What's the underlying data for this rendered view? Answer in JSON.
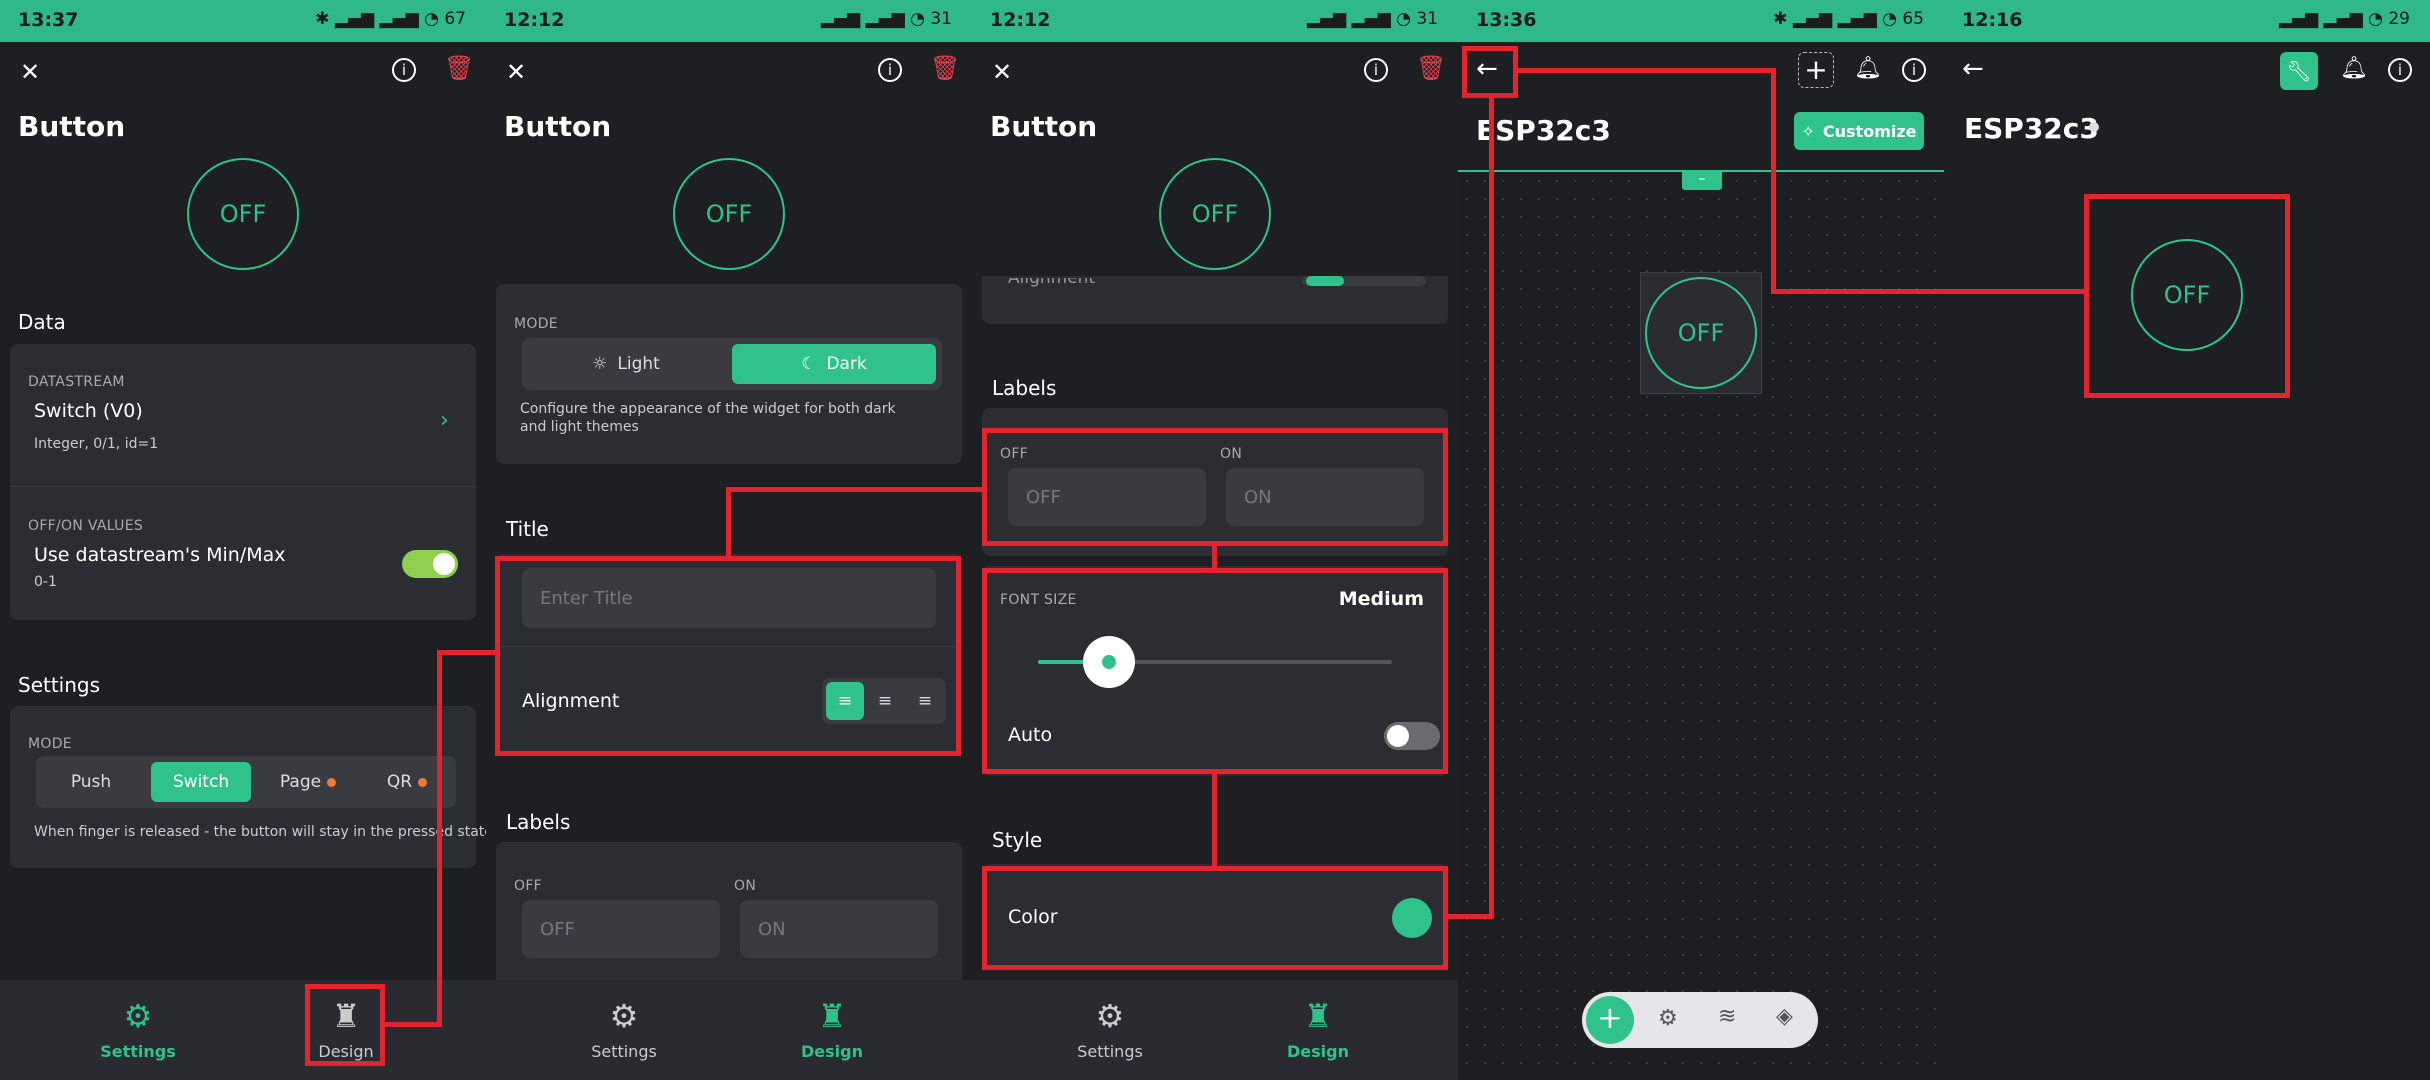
{
  "panels": {
    "p1": {
      "status_time": "13:37",
      "status_right": "✱ ▂▄▆ ▂▄▆ ◔ 67",
      "title": "Button",
      "widget_text": "OFF",
      "data_heading": "Data",
      "datastream_cap": "DATASTREAM",
      "datastream_name": "Switch (V0)",
      "datastream_meta": "Integer, 0/1, id=1",
      "offon_cap": "OFF/ON VALUES",
      "offon_text": "Use datastream's Min/Max",
      "offon_range": "0-1",
      "settings_heading": "Settings",
      "mode_cap": "MODE",
      "modes": [
        "Push",
        "Switch",
        "Page",
        "QR"
      ],
      "mode_help": "When finger is released - the button will stay in the pressed state",
      "nav_settings": "Settings",
      "nav_design": "Design"
    },
    "p2": {
      "status_time": "12:12",
      "status_right": "▂▄▆ ▂▄▆ ◔ 31",
      "title": "Button",
      "widget_text": "OFF",
      "mode_cap": "MODE",
      "mode_light": "Light",
      "mode_dark": "Dark",
      "mode_help": "Configure the appearance of the widget for both dark and light themes",
      "title_heading": "Title",
      "title_placeholder": "Enter Title",
      "alignment_label": "Alignment",
      "labels_heading": "Labels",
      "off_cap": "OFF",
      "on_cap": "ON",
      "off_placeholder": "OFF",
      "on_placeholder": "ON",
      "nav_settings": "Settings",
      "nav_design": "Design"
    },
    "p3": {
      "status_time": "12:12",
      "status_right": "▂▄▆ ▂▄▆ ◔ 31",
      "title": "Button",
      "widget_text": "OFF",
      "alignment_partial": "Alignment",
      "labels_heading": "Labels",
      "off_cap": "OFF",
      "on_cap": "ON",
      "off_placeholder": "OFF",
      "on_placeholder": "ON",
      "font_size_cap": "FONT SIZE",
      "font_size_value": "Medium",
      "font_size_level": 0.2,
      "auto_label": "Auto",
      "style_heading": "Style",
      "color_label": "Color",
      "color_value": "#2fc38b",
      "nav_settings": "Settings",
      "nav_design": "Design"
    },
    "p4": {
      "status_time": "13:36",
      "status_right": "✱ ▂▄▆ ▂▄▆ ◔ 65",
      "device_name": "ESP32c3",
      "customize_label": "Customize",
      "widget_text": "OFF"
    },
    "p5": {
      "status_time": "12:16",
      "status_right": "▂▄▆ ▂▄▆ ◔ 29",
      "device_name": "ESP32c3",
      "widget_text": "OFF"
    }
  },
  "colors": {
    "accent": "#2fc38b",
    "highlight": "#e3232d",
    "delete": "#e0414a"
  }
}
